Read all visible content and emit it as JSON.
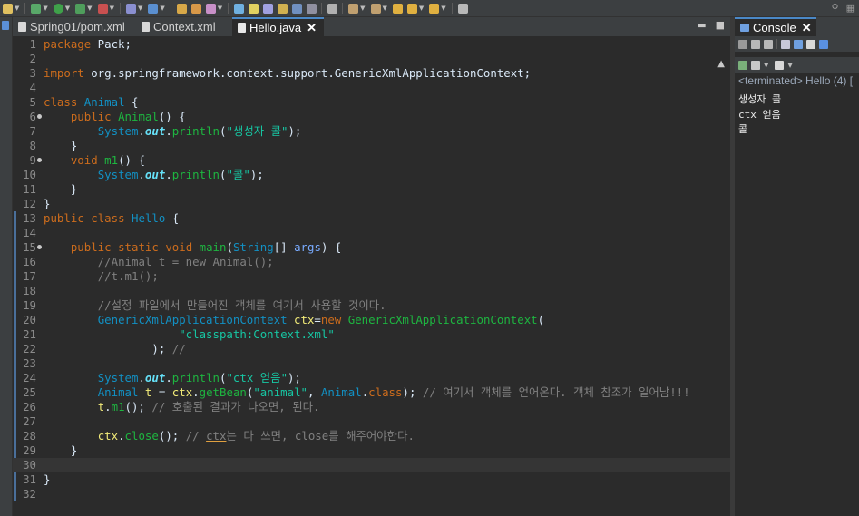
{
  "tabs": [
    {
      "label": "Spring01/pom.xml",
      "icon": "xml-file-icon",
      "active": false
    },
    {
      "label": "Context.xml",
      "icon": "xml-file-icon",
      "active": false
    },
    {
      "label": "Hello.java",
      "icon": "java-file-icon",
      "active": true
    }
  ],
  "code_lines": [
    {
      "num": "1",
      "tokens": [
        [
          "k",
          "package"
        ],
        [
          "",
          " Pack;"
        ]
      ]
    },
    {
      "num": "2",
      "tokens": []
    },
    {
      "num": "3",
      "tokens": [
        [
          "k",
          "import"
        ],
        [
          "",
          " org.springframework.context.support.GenericXmlApplicationContext;"
        ]
      ]
    },
    {
      "num": "4",
      "tokens": []
    },
    {
      "num": "5",
      "tokens": [
        [
          "k",
          "class"
        ],
        [
          "",
          " "
        ],
        [
          "t",
          "Animal"
        ],
        [
          "",
          " {"
        ]
      ]
    },
    {
      "num": "6",
      "marker": true,
      "tokens": [
        [
          "",
          "    "
        ],
        [
          "k",
          "public"
        ],
        [
          "",
          " "
        ],
        [
          "m",
          "Animal"
        ],
        [
          "",
          "() {"
        ]
      ]
    },
    {
      "num": "7",
      "tokens": [
        [
          "",
          "        "
        ],
        [
          "t",
          "System"
        ],
        [
          "",
          "."
        ],
        [
          "f",
          "out"
        ],
        [
          "",
          "."
        ],
        [
          "m",
          "println"
        ],
        [
          "",
          "("
        ],
        [
          "s",
          "\"생성자 콜\""
        ],
        [
          "",
          ");"
        ]
      ]
    },
    {
      "num": "8",
      "tokens": [
        [
          "",
          "    }"
        ]
      ]
    },
    {
      "num": "9",
      "marker": true,
      "tokens": [
        [
          "",
          "    "
        ],
        [
          "k",
          "void"
        ],
        [
          "",
          " "
        ],
        [
          "m",
          "m1"
        ],
        [
          "",
          "() {"
        ]
      ]
    },
    {
      "num": "10",
      "tokens": [
        [
          "",
          "        "
        ],
        [
          "t",
          "System"
        ],
        [
          "",
          "."
        ],
        [
          "f",
          "out"
        ],
        [
          "",
          "."
        ],
        [
          "m",
          "println"
        ],
        [
          "",
          "("
        ],
        [
          "s",
          "\"콜\""
        ],
        [
          "",
          ");"
        ]
      ]
    },
    {
      "num": "11",
      "tokens": [
        [
          "",
          "    }"
        ]
      ]
    },
    {
      "num": "12",
      "tokens": [
        [
          "",
          "}"
        ]
      ]
    },
    {
      "num": "13",
      "tokens": [
        [
          "k",
          "public"
        ],
        [
          "",
          " "
        ],
        [
          "k",
          "class"
        ],
        [
          "",
          " "
        ],
        [
          "t",
          "Hello"
        ],
        [
          "",
          " {"
        ]
      ]
    },
    {
      "num": "14",
      "tokens": []
    },
    {
      "num": "15",
      "marker": true,
      "tokens": [
        [
          "",
          "    "
        ],
        [
          "k",
          "public"
        ],
        [
          "",
          " "
        ],
        [
          "k",
          "static"
        ],
        [
          "",
          " "
        ],
        [
          "k",
          "void"
        ],
        [
          "",
          " "
        ],
        [
          "m",
          "main"
        ],
        [
          "",
          "("
        ],
        [
          "t",
          "String"
        ],
        [
          "",
          "[] "
        ],
        [
          "p",
          "args"
        ],
        [
          "",
          ") {"
        ]
      ]
    },
    {
      "num": "16",
      "tokens": [
        [
          "",
          "        "
        ],
        [
          "c",
          "//Animal t = new Animal();"
        ]
      ]
    },
    {
      "num": "17",
      "tokens": [
        [
          "",
          "        "
        ],
        [
          "c",
          "//t.m1();"
        ]
      ]
    },
    {
      "num": "18",
      "tokens": []
    },
    {
      "num": "19",
      "tokens": [
        [
          "",
          "        "
        ],
        [
          "c",
          "//설정 파일에서 만들어진 객체를 여기서 사용할 것이다."
        ]
      ]
    },
    {
      "num": "20",
      "tokens": [
        [
          "",
          "        "
        ],
        [
          "t",
          "GenericXmlApplicationContext"
        ],
        [
          "",
          " "
        ],
        [
          "v",
          "ctx"
        ],
        [
          "",
          "="
        ],
        [
          "k",
          "new"
        ],
        [
          "",
          " "
        ],
        [
          "m",
          "GenericXmlApplicationContext"
        ],
        [
          "",
          "("
        ]
      ]
    },
    {
      "num": "21",
      "tokens": [
        [
          "",
          "                    "
        ],
        [
          "s",
          "\"classpath:Context.xml\""
        ]
      ]
    },
    {
      "num": "22",
      "tokens": [
        [
          "",
          "                ); "
        ],
        [
          "c",
          "//"
        ]
      ]
    },
    {
      "num": "23",
      "tokens": []
    },
    {
      "num": "24",
      "tokens": [
        [
          "",
          "        "
        ],
        [
          "t",
          "System"
        ],
        [
          "",
          "."
        ],
        [
          "f",
          "out"
        ],
        [
          "",
          "."
        ],
        [
          "m",
          "println"
        ],
        [
          "",
          "("
        ],
        [
          "s",
          "\"ctx 얻음\""
        ],
        [
          "",
          ");"
        ]
      ]
    },
    {
      "num": "25",
      "tokens": [
        [
          "",
          "        "
        ],
        [
          "t",
          "Animal"
        ],
        [
          "",
          " "
        ],
        [
          "v",
          "t"
        ],
        [
          "",
          " = "
        ],
        [
          "v",
          "ctx"
        ],
        [
          "",
          "."
        ],
        [
          "m",
          "getBean"
        ],
        [
          "",
          "("
        ],
        [
          "s",
          "\"animal\""
        ],
        [
          "",
          ", "
        ],
        [
          "t",
          "Animal"
        ],
        [
          "",
          "."
        ],
        [
          "k",
          "class"
        ],
        [
          "",
          "); "
        ],
        [
          "c",
          "// 여기서 객체를 얻어온다. 객체 참조가 일어남!!!"
        ]
      ]
    },
    {
      "num": "26",
      "tokens": [
        [
          "",
          "        "
        ],
        [
          "v",
          "t"
        ],
        [
          "",
          "."
        ],
        [
          "m",
          "m1"
        ],
        [
          "",
          "(); "
        ],
        [
          "c",
          "// 호출된 결과가 나오면, 된다."
        ]
      ]
    },
    {
      "num": "27",
      "tokens": []
    },
    {
      "num": "28",
      "tokens": [
        [
          "",
          "        "
        ],
        [
          "v",
          "ctx"
        ],
        [
          "",
          "."
        ],
        [
          "m",
          "close"
        ],
        [
          "",
          "(); "
        ],
        [
          "c",
          "// "
        ],
        [
          "c u",
          "ctx"
        ],
        [
          "c",
          "는 다 쓰면, close를 해주어야한다."
        ]
      ]
    },
    {
      "num": "29",
      "tokens": [
        [
          "",
          "    }"
        ]
      ]
    },
    {
      "num": "30",
      "current": true,
      "tokens": []
    },
    {
      "num": "31",
      "tokens": [
        [
          "",
          "}"
        ]
      ]
    },
    {
      "num": "32",
      "tokens": []
    }
  ],
  "console": {
    "tab_label": "Console",
    "terminated": "<terminated> Hello (4) [",
    "output": [
      "생성자 콜",
      "ctx 얻음",
      "콜"
    ]
  },
  "colors": {
    "keyword": "#cc6c1d",
    "type": "#1290c3",
    "method": "#1eb540",
    "string": "#17c6a3",
    "comment": "#808080",
    "static_field": "#66e1f8",
    "variable": "#f3ec79",
    "background": "#2b2b2b"
  }
}
